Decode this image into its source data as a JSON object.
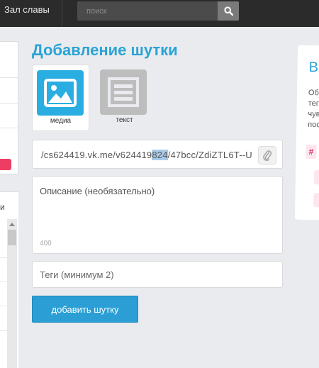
{
  "topbar": {
    "hall_of_fame": "Зал славы",
    "search_placeholder": "поиск"
  },
  "sidebar": {
    "bottom_fragment": "и"
  },
  "form": {
    "title": "Добавление шутки",
    "types": [
      {
        "label": "медиа",
        "icon": "image-icon",
        "active": true
      },
      {
        "label": "текст",
        "icon": "text-lines-icon",
        "active": false
      }
    ],
    "url_value_before": "/cs624419.vk.me/v624419",
    "url_value_selected": "824",
    "url_value_after": "/47bcc/ZdiZTL6T--U",
    "description_placeholder": "Описание (необязательно)",
    "description_counter": "400",
    "tags_placeholder": "Теги (минимум 2)",
    "submit_label": "добавить шутку"
  },
  "right_panel": {
    "heading": "Вы",
    "desc_lines": [
      "Об",
      "тег",
      "чув",
      "пос"
    ],
    "tag": "#"
  },
  "colors": {
    "accent": "#2aa3d6",
    "topbar": "#2b2b2b",
    "tag_pink": "#d43866"
  }
}
